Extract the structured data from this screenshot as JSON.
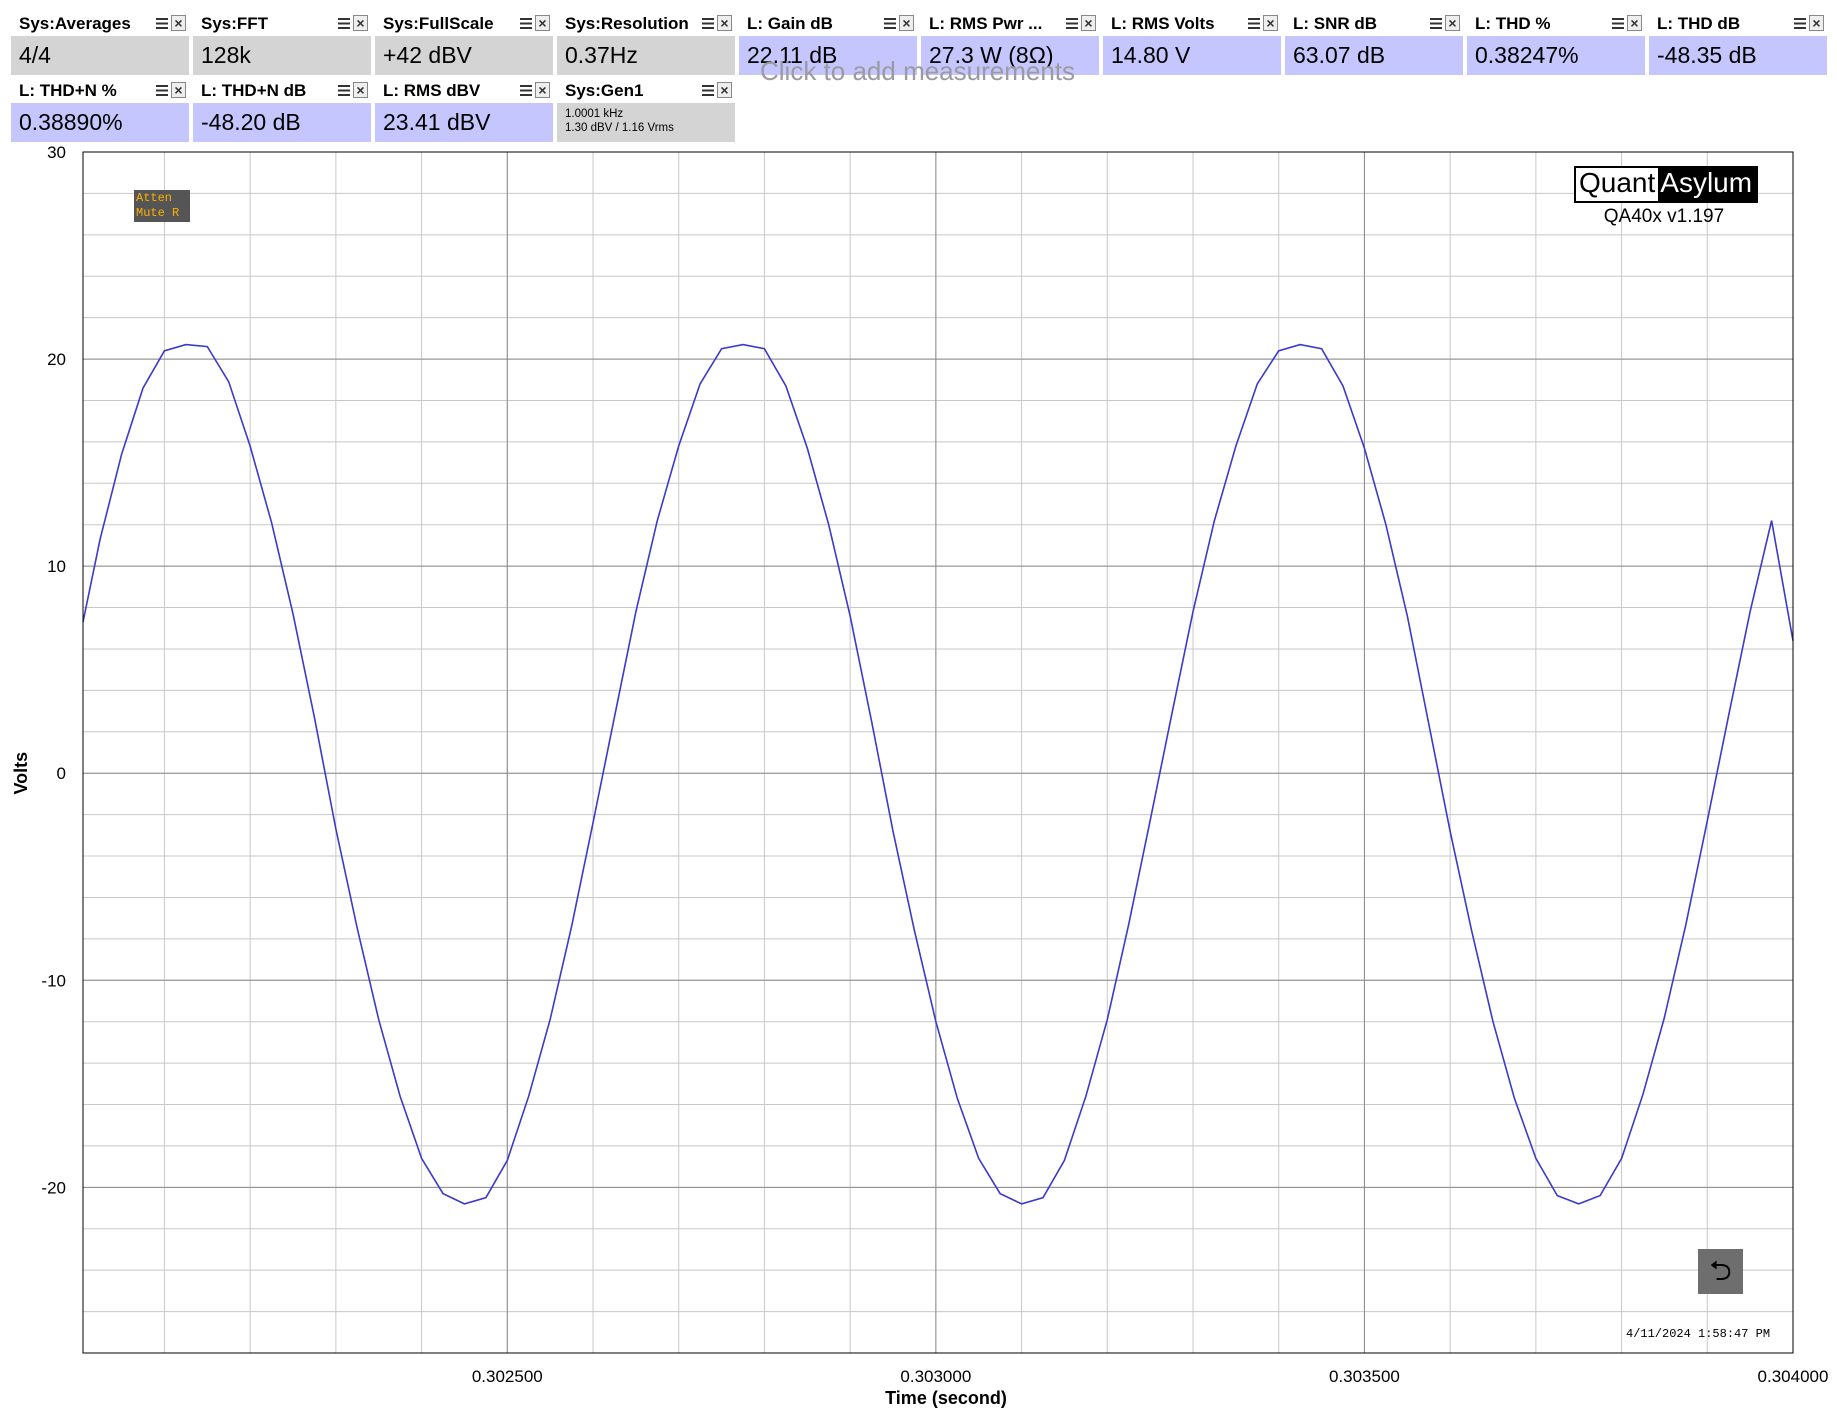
{
  "measurements": [
    {
      "label": "Sys:Averages",
      "value": "4/4",
      "kind": "sys"
    },
    {
      "label": "Sys:FFT",
      "value": "128k",
      "kind": "sys"
    },
    {
      "label": "Sys:FullScale",
      "value": "+42 dBV",
      "kind": "sys"
    },
    {
      "label": "Sys:Resolution",
      "value": "0.37Hz",
      "kind": "sys"
    },
    {
      "label": "L: Gain dB",
      "value": "22.11 dB",
      "kind": "meas"
    },
    {
      "label": "L: RMS Pwr ...",
      "value": "27.3 W (8Ω)",
      "kind": "meas"
    },
    {
      "label": "L: RMS Volts",
      "value": "14.80 V",
      "kind": "meas"
    },
    {
      "label": "L: SNR dB",
      "value": "63.07 dB",
      "kind": "meas"
    },
    {
      "label": "L: THD %",
      "value": "0.38247%",
      "kind": "meas"
    },
    {
      "label": "L: THD dB",
      "value": "-48.35 dB",
      "kind": "meas"
    },
    {
      "label": "L: THD+N %",
      "value": "0.38890%",
      "kind": "meas"
    },
    {
      "label": "L: THD+N dB",
      "value": "-48.20 dB",
      "kind": "meas"
    },
    {
      "label": "L: RMS dBV",
      "value": "23.41 dBV",
      "kind": "meas"
    }
  ],
  "generator": {
    "label": "Sys:Gen1",
    "line1": "1.0001 kHz",
    "line2": "1.30 dBV  / 1.16 Vrms"
  },
  "add_measurement_hint": "Click to add measurements",
  "status_badge": {
    "line1": "Atten",
    "line2": "Mute R"
  },
  "logo": {
    "part1": "Quant",
    "part2": "Asylum"
  },
  "version": "QA40x v1.197",
  "timestamp": "4/11/2024 1:58:47 PM",
  "icons": {
    "tile_menu": "menu-icon",
    "tile_close": "close-icon",
    "back": "undo-arrow-icon"
  },
  "chart_data": {
    "type": "line",
    "xlabel": "Time (second)",
    "ylabel": "Volts",
    "xlim": [
      0.302005,
      0.304
    ],
    "ylim": [
      -28,
      30
    ],
    "x_ticks": [
      0.3025,
      0.303,
      0.3035,
      0.304
    ],
    "x_tick_labels": [
      "0.302500",
      "0.303000",
      "0.303500",
      "0.304000"
    ],
    "y_ticks": [
      30,
      20,
      10,
      0,
      -10,
      -20
    ],
    "y_tick_labels": [
      "30",
      "20",
      "10",
      "0",
      "-10",
      "-20"
    ],
    "grid": true,
    "color": "#3a3acc",
    "series": [
      {
        "x": [
          0.302005,
          0.302025,
          0.30205,
          0.302075,
          0.3021,
          0.302125,
          0.30215,
          0.302175,
          0.3022,
          0.302225,
          0.30225,
          0.302275,
          0.3023,
          0.302325,
          0.30235,
          0.302375,
          0.3024,
          0.302425,
          0.30245,
          0.302475,
          0.3025,
          0.302525,
          0.30255,
          0.302575,
          0.3026,
          0.302625,
          0.30265,
          0.302675,
          0.3027,
          0.302725,
          0.30275,
          0.302775,
          0.3028,
          0.302825,
          0.30285,
          0.302875,
          0.3029,
          0.302925,
          0.30295,
          0.302975,
          0.303,
          0.303025,
          0.30305,
          0.303075,
          0.3031,
          0.303125,
          0.30315,
          0.303175,
          0.3032,
          0.303225,
          0.30325,
          0.303275,
          0.3033,
          0.303325,
          0.30335,
          0.303375,
          0.3034,
          0.303425,
          0.30345,
          0.303475,
          0.3035,
          0.303525,
          0.30355,
          0.303575,
          0.3036,
          0.303625,
          0.30365,
          0.303675,
          0.3037,
          0.303725,
          0.30375,
          0.303775,
          0.3038,
          0.303825,
          0.30385,
          0.303875,
          0.3039,
          0.303925,
          0.30395,
          0.303975,
          0.304
        ],
        "y": [
          7.3,
          11.3,
          15.4,
          18.6,
          20.4,
          20.7,
          20.6,
          18.9,
          15.8,
          12.1,
          7.7,
          2.7,
          -2.7,
          -7.5,
          -11.9,
          -15.6,
          -18.6,
          -20.3,
          -20.8,
          -20.5,
          -18.7,
          -15.6,
          -11.9,
          -7.4,
          -2.4,
          2.7,
          7.8,
          12.2,
          15.8,
          18.8,
          20.5,
          20.7,
          20.5,
          18.7,
          15.7,
          12.0,
          7.6,
          2.5,
          -2.8,
          -7.6,
          -12.0,
          -15.7,
          -18.6,
          -20.3,
          -20.8,
          -20.5,
          -18.7,
          -15.6,
          -11.9,
          -7.3,
          -2.3,
          2.8,
          7.8,
          12.2,
          15.8,
          18.8,
          20.4,
          20.7,
          20.5,
          18.7,
          15.7,
          12.0,
          7.6,
          2.4,
          -2.8,
          -7.6,
          -12.0,
          -15.7,
          -18.6,
          -20.4,
          -20.8,
          -20.4,
          -18.6,
          -15.5,
          -11.8,
          -7.3,
          -2.3,
          2.8,
          7.8,
          12.2,
          6.4
        ]
      }
    ]
  }
}
